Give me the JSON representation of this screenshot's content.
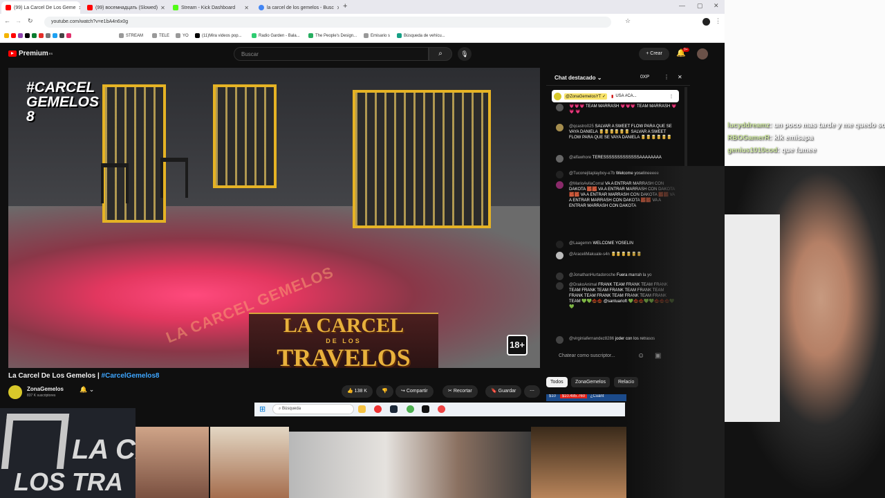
{
  "browser": {
    "tabs": [
      {
        "label": "(99) La Carcel De Los Geme",
        "active": true
      },
      {
        "label": "(99) восемнадцать (Slowed)",
        "active": false
      },
      {
        "label": "Stream - Kick Dashboard",
        "active": false
      },
      {
        "label": "la carcel de los gemelos - Busc",
        "active": false
      }
    ],
    "new_tab": "+",
    "url": "youtube.com/watch?v=e1bA4n6x0g",
    "bookmarks": [
      "STREAM",
      "TELE",
      "YO",
      "(11)Mira videos pop...",
      "Radio Garden - Bala...",
      "The People's Design...",
      "Emisario s",
      "Búsqueda de vehícu..."
    ]
  },
  "youtube": {
    "logo": "Premium",
    "logo_region": "ES",
    "search_placeholder": "Buscar",
    "create_label": "Crear",
    "bell_badge": "9+"
  },
  "video": {
    "overlay_tag": "#CARCEL GEMELOS 8",
    "floor_text": "LA CARCEL GEMELOS",
    "banner_line1": "LA CARCEL",
    "banner_line2": "DE LOS",
    "banner_line3": "TRAVELOS",
    "age_badge": "18+",
    "title": "La Carcel De Los Gemelos | ",
    "title_hashtag": "#CarcelGemelos8",
    "channel": "ZonaGemelos",
    "subscribers": "837 K suscriptores",
    "likes": "138 K",
    "share": "Compartir",
    "clip": "Recortar",
    "save": "Guardar",
    "more": "⋯"
  },
  "chat": {
    "title": "Chat destacado",
    "points": "0XP",
    "pinned_author": "@ZonaGemelosYT ✓",
    "pinned_text": "USA #CA...",
    "messages": [
      {
        "author": "",
        "text": "💗💗💗 TEAM MARRASH 💗💗💗 TEAM MARRASH 💗 💗 💗",
        "color": "#555"
      },
      {
        "author": "@qcastro025",
        "text": "SALVAR A SWEET FLOW PARA QUE SE VAYA DANIELA 🥫🥫🥫🥫🥫🥫 SALVAR A SWEET FLOW PARA QUE SE VAYA DANIELA 🥫🥫🥫🥫🥫🥫",
        "color": "#a58d4e"
      },
      {
        "author": "@alfawhore",
        "text": "TERESSSSSSSSSSSSSAAAAAAAA",
        "color": "#666"
      },
      {
        "author": "@Tuconejitaplayboy-e7b",
        "text": "Welcome yoselineeeee",
        "color": "#222"
      },
      {
        "author": "@MarioAvilaCorral",
        "text": "VA A ENTRAR MARRASH CON DAKOTA 🧱🧱 VA A ENTRAR MARRASH CON DAKOTA 🧱🧱 VA A ENTRAR MARRASH CON DAKOTA 🧱🧱 VA A ENTRAR MARRASH CON DAKOTA 🧱🧱 VA A ENTRAR MARRASH CON DAKOTA",
        "color": "#8a2a6a"
      },
      {
        "author": "@Laagemm",
        "text": "WELCOME YOSELIN",
        "color": "#222"
      },
      {
        "author": "@AraceliMakuale-s4n",
        "text": "🥫🥫🥫🥫🥫🥫",
        "color": "#bbb"
      },
      {
        "author": "@JonathanHurtadoroche",
        "text": "Fuera marrah la yo",
        "color": "#333"
      },
      {
        "author": "@DrakoAnimal",
        "text": "FRANK TEAM FRANK TEAM FRANK TEAM FRANK TEAM FRANK TEAM FRANK TEAM FRANK TEAM FRANK TEAM FRANK TEAM FRANK TEAM 💚💚🌰🌰 @santuarioft 💚🌰🌰💚💚🌰🌰🌰💚💚",
        "color": "#333"
      },
      {
        "author": "@virginiafernandez8286",
        "text": "joder con los retrasos",
        "color": "#444"
      }
    ],
    "input_placeholder": "Chatear como suscriptor...",
    "chips": [
      "Todos",
      "ZonaGemelos",
      "Relacio"
    ],
    "superchat_amount": "$10",
    "superchat_total": "$10.485.760",
    "superchat_text": "¿Cuánt"
  },
  "taskbar": {
    "search_placeholder": "Búsqueda"
  },
  "stream_overlay": {
    "chat": [
      {
        "name": "lucyddreamz",
        "text": ": un poco mas tarde y me quedo so"
      },
      {
        "name": "RBOGamerR",
        "text": ": klk emisapa"
      },
      {
        "name": "genius1010cod",
        "text": ": que fumee"
      }
    ],
    "lower_text_1": "LA CA",
    "lower_text_2": "LOS TRA"
  },
  "colors": {
    "yt_bg": "#0f0f0f",
    "accent_red": "#ff0000",
    "link_blue": "#3ea6ff",
    "jail_yellow": "#e6b324",
    "banner_gold": "#e8b13c"
  }
}
